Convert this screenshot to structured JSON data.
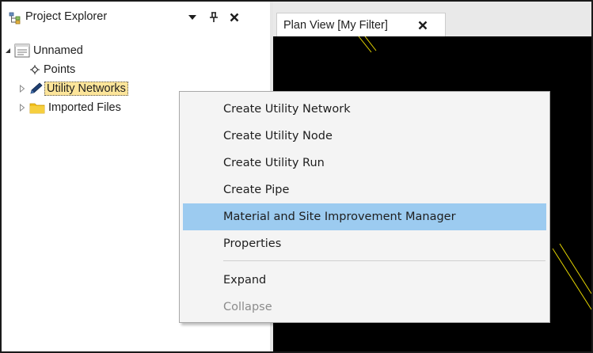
{
  "explorer": {
    "title": "Project Explorer",
    "tree": [
      {
        "label": "Unnamed",
        "expanded": true,
        "icon": "document-icon"
      },
      {
        "label": "Points",
        "icon": "point-icon"
      },
      {
        "label": "Utility Networks",
        "selected": true,
        "icon": "pencil-icon"
      },
      {
        "label": "Imported Files",
        "icon": "folder-icon"
      }
    ]
  },
  "document": {
    "tab_label": "Plan View [My Filter]"
  },
  "context_menu": {
    "items": [
      {
        "label": "Create Utility Network"
      },
      {
        "label": "Create Utility Node"
      },
      {
        "label": "Create Utility Run"
      },
      {
        "label": "Create Pipe"
      },
      {
        "label": "Material and Site Improvement Manager",
        "highlighted": true
      },
      {
        "label": "Properties"
      },
      {
        "label": "Expand"
      },
      {
        "label": "Collapse",
        "disabled": true
      }
    ]
  },
  "colors": {
    "selection_fill": "#fde59a",
    "menu_highlight": "#9ccbf0",
    "canvas_background": "#000000",
    "linework": "#e8d800",
    "folder": "#f2c01a"
  }
}
